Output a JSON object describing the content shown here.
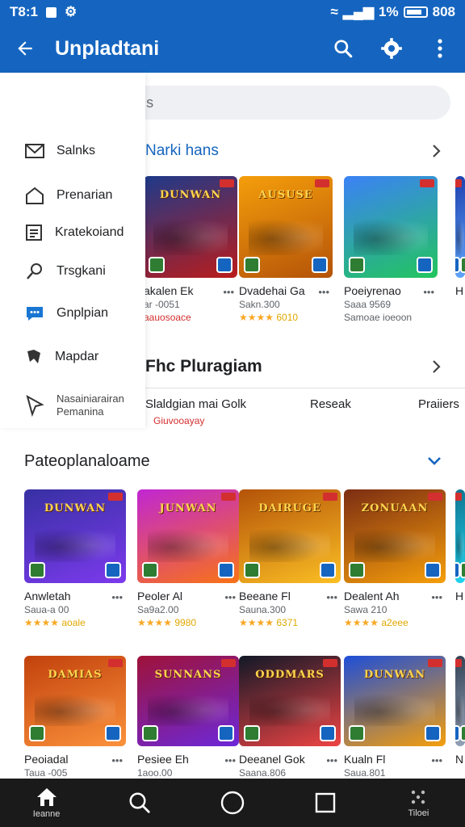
{
  "status_bar": {
    "time": "T8:1",
    "battery": "1%",
    "clock_right": "808"
  },
  "app_bar": {
    "title": "Unpladtani"
  },
  "search": {
    "placeholder": "Pencaigkjanh:s"
  },
  "drawer": {
    "items": [
      {
        "label": "Salnks",
        "icon": "mail-icon"
      },
      {
        "label": "Prenarian",
        "icon": "home-icon"
      },
      {
        "label": "Kratekoiand",
        "icon": "list-icon"
      },
      {
        "label": "Trsgkani",
        "icon": "link-icon"
      },
      {
        "label": "Gnplpian",
        "icon": "chat-icon"
      },
      {
        "label": "Mapdar",
        "icon": "map-icon"
      },
      {
        "label": "Nasainiarairan",
        "label2": "Pemanina",
        "icon": "compass-icon"
      }
    ]
  },
  "section1": {
    "title": "Narki hans",
    "tiles": [
      {
        "name": "akalen Ek",
        "meta": "ar -0051",
        "sub": "aauosoace",
        "art_title": "DUNWAN",
        "colors": [
          "#1e3a8a",
          "#b91c1c"
        ]
      },
      {
        "name": "Dvadehai Ga",
        "meta": "Sakn.300",
        "rating": "6010",
        "art_title": "AUSUSE",
        "colors": [
          "#f59e0b",
          "#b45309"
        ]
      },
      {
        "name": "Poeiyrenao",
        "meta": "Saaa 9569",
        "sub": "Samoae ioeoon",
        "art_title": "",
        "colors": [
          "#3b82f6",
          "#22c55e"
        ]
      },
      {
        "name": "H",
        "meta": "",
        "art_title": "",
        "colors": [
          "#1e40af",
          "#60a5fa"
        ]
      }
    ]
  },
  "section2": {
    "title": "Fhc Pluragiam",
    "filters": [
      "Slaldgian mai Golk",
      "Reseak",
      "Praiiers"
    ],
    "filter_sub": "Giuvooayay"
  },
  "section3": {
    "title": "Pateoplanaloame",
    "row1": [
      {
        "name": "Anwletah",
        "meta": "Saua-a 00",
        "rating": "aoale",
        "art_title": "DUNWAN",
        "colors": [
          "#3730a3",
          "#7c3aed"
        ]
      },
      {
        "name": "Peoler Al",
        "meta": "Sa9a2.00",
        "rating": "9980",
        "art_title": "JUNWAN",
        "colors": [
          "#c026d3",
          "#f97316"
        ]
      },
      {
        "name": "Beeane Fl",
        "meta": "Sauna.300",
        "rating": "6371",
        "art_title": "DAIRUGE",
        "colors": [
          "#b45309",
          "#fbbf24"
        ]
      },
      {
        "name": "Dealent Ah",
        "meta": "Sawa 210",
        "rating": "a2eee",
        "art_title": "ZONUAAN",
        "colors": [
          "#7c2d12",
          "#f59e0b"
        ]
      },
      {
        "name": "H",
        "meta": "",
        "rating": "",
        "art_title": "",
        "colors": [
          "#0e7490",
          "#22d3ee"
        ]
      }
    ],
    "row2": [
      {
        "name": "Peoiadal",
        "meta": "Taua -005",
        "art_title": "DAMIAS",
        "colors": [
          "#c2410c",
          "#fb923c"
        ]
      },
      {
        "name": "Pesiee Eh",
        "meta": "1aoo.00",
        "art_title": "SUNNANS",
        "colors": [
          "#9f1239",
          "#6d28d9"
        ]
      },
      {
        "name": "Deeanel Gok",
        "meta": "Saana.806",
        "art_title": "ODDMARS",
        "colors": [
          "#111827",
          "#ef4444"
        ]
      },
      {
        "name": "Kualn Fl",
        "meta": "Saua.801",
        "art_title": "DUNWAN",
        "colors": [
          "#1d4ed8",
          "#f59e0b"
        ]
      },
      {
        "name": "N",
        "meta": "",
        "art_title": "",
        "colors": [
          "#334155",
          "#94a3b8"
        ]
      }
    ]
  },
  "nav_bar": {
    "items": [
      {
        "label": "Ieanne",
        "icon": "home-icon"
      },
      {
        "label": "",
        "icon": "search-icon"
      },
      {
        "label": "",
        "icon": "circle-icon"
      },
      {
        "label": "",
        "icon": "square-icon"
      },
      {
        "label": "Tiloei",
        "icon": "dots-icon"
      }
    ]
  },
  "colors": {
    "primary": "#1565c0",
    "star": "#f9a825",
    "alert": "#d32f2f"
  }
}
